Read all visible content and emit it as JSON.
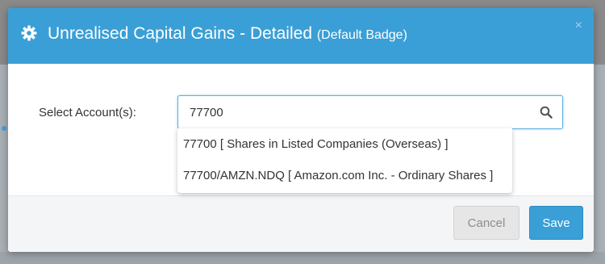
{
  "modal": {
    "title": "Unrealised Capital Gains - Detailed",
    "subtitle": "(Default Badge)",
    "close_icon": "×",
    "header_icon": "gear-icon"
  },
  "form": {
    "account_label": "Select Account(s):",
    "search_value": "77700",
    "search_icon": "search-icon"
  },
  "dropdown": {
    "items": [
      "77700 [ Shares in Listed Companies (Overseas) ]",
      "77700/AMZN.NDQ [ Amazon.com Inc. - Ordinary Shares ]"
    ]
  },
  "footer": {
    "cancel_label": "Cancel",
    "save_label": "Save"
  },
  "colors": {
    "header": "#3a9fd6",
    "primary_button": "#3a9fd6",
    "cancel_button": "#e6e6e6"
  }
}
